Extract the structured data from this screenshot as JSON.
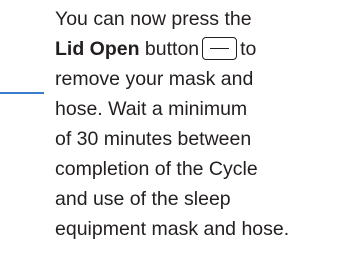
{
  "instruction": {
    "line1": "You can now press the",
    "lid_open_label": "Lid Open",
    "line2_after_bold": "button",
    "line2_end": "to",
    "line3": "remove your mask and",
    "line4": "hose. Wait a minimum",
    "line5": "of 30 minutes between",
    "line6": "completion of the Cycle",
    "line7": "and use of the sleep",
    "line8": "equipment mask and hose."
  },
  "icons": {
    "lid_open_button": "lid-open-button-icon"
  },
  "colors": {
    "text": "#231f20",
    "leader_line": "#3a7cc9"
  }
}
